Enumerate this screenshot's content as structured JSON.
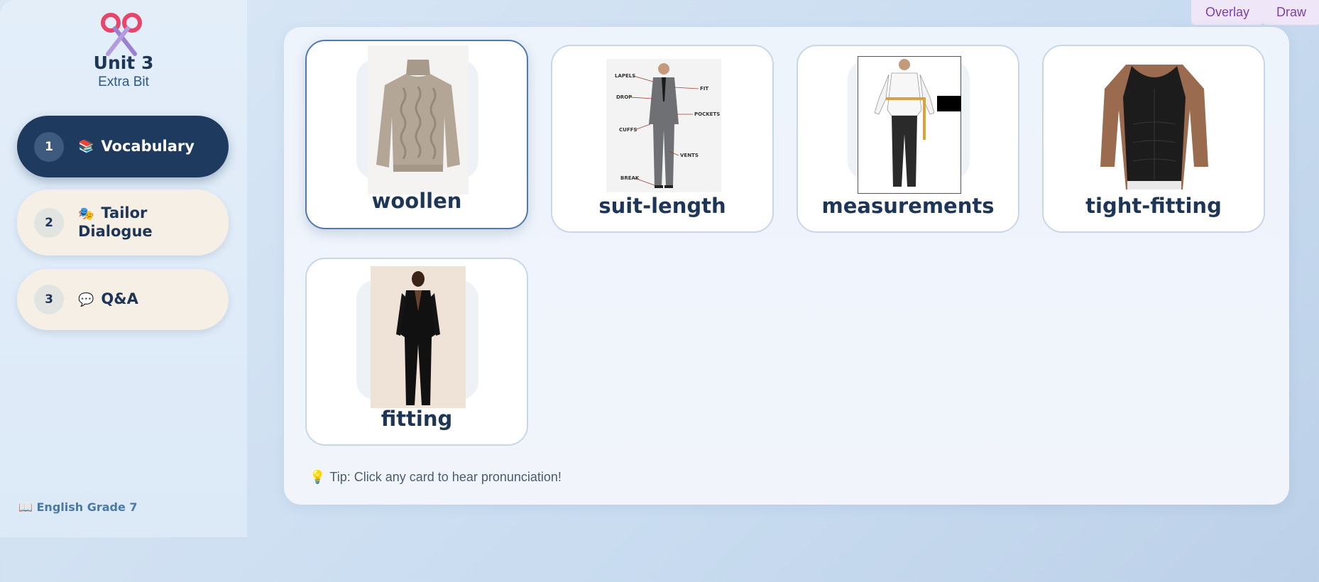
{
  "sidebar": {
    "logo_icon": "scissors-icon",
    "title": "Unit 3",
    "subtitle": "Extra Bit",
    "items": [
      {
        "number": "1",
        "emoji": "📚",
        "label": "Vocabulary",
        "icon": "books-icon"
      },
      {
        "number": "2",
        "emoji": "🎭",
        "label": "Tailor Dialogue",
        "icon": "theater-masks-icon"
      },
      {
        "number": "3",
        "emoji": "💬",
        "label": "Q&A",
        "icon": "speech-bubble-icon"
      }
    ],
    "footer": "📖 English Grade 7"
  },
  "toolbar": {
    "overlay_label": "Overlay",
    "draw_label": "Draw"
  },
  "cards": [
    {
      "word": "woollen",
      "image": "knit-turtleneck-sweater",
      "selected": true
    },
    {
      "word": "suit-length",
      "image": "annotated-suit-diagram",
      "selected": false
    },
    {
      "word": "measurements",
      "image": "man-being-measured",
      "selected": false
    },
    {
      "word": "tight-fitting",
      "image": "black-compression-tank",
      "selected": false
    },
    {
      "word": "fitting",
      "image": "woman-in-black-suit",
      "selected": false
    }
  ],
  "suit_annotations": [
    "LAPELS",
    "FIT",
    "DROP",
    "POCKETS",
    "CUFFS",
    "VENTS",
    "BREAK"
  ],
  "tip": {
    "icon": "lightbulb-icon",
    "text": "Tip: Click any card to hear pronunciation!"
  },
  "colors": {
    "accent": "#1e3a5f",
    "inactive_nav": "#f5efe6",
    "toolbar_button": "#efe6f8",
    "toolbar_text": "#7a3fb0"
  }
}
